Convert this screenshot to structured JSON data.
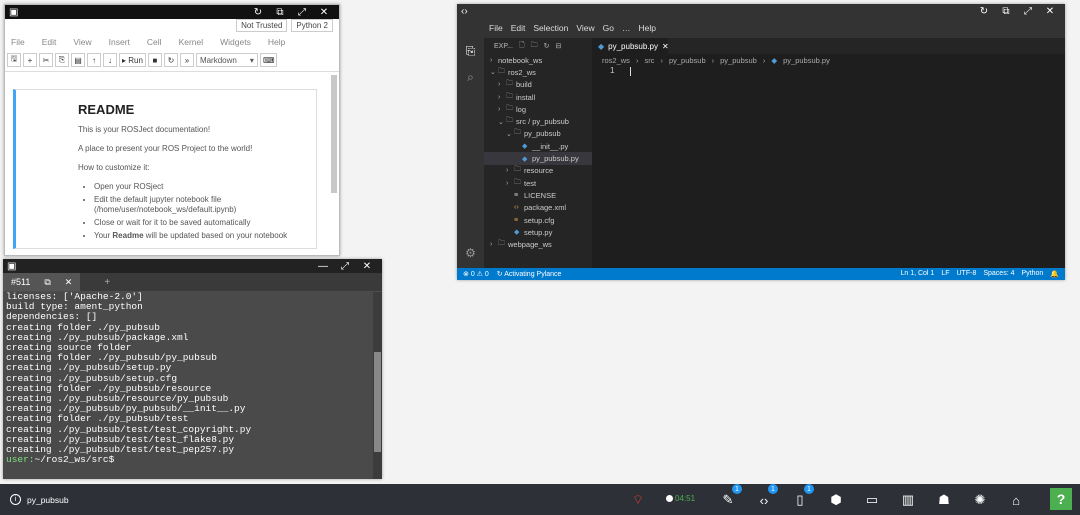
{
  "jupyter": {
    "trust_label": "Not Trusted",
    "kernel_label": "Python 2",
    "menu": [
      "File",
      "Edit",
      "View",
      "Insert",
      "Cell",
      "Kernel",
      "Widgets",
      "Help"
    ],
    "run_label": "Run",
    "cell_type": "Markdown",
    "readme": {
      "title": "README",
      "p1": "This is your ROSJect documentation!",
      "p2": "A place to present your ROS Project to the world!",
      "p3": "How to customize it:",
      "li1": "Open your ROSject",
      "li2": "Edit the default jupyter notebook file (/home/user/notebook_ws/default.ipynb)",
      "li3": "Close or wait for it to be saved automatically",
      "li4_pre": "Your ",
      "li4_bold": "Readme",
      "li4_post": " will be updated based on your notebook"
    }
  },
  "terminal": {
    "tab_label": "#511",
    "lines": [
      "licenses: ['Apache-2.0']",
      "build type: ament_python",
      "dependencies: []",
      "creating folder ./py_pubsub",
      "creating ./py_pubsub/package.xml",
      "creating source folder",
      "creating folder ./py_pubsub/py_pubsub",
      "creating ./py_pubsub/setup.py",
      "creating ./py_pubsub/setup.cfg",
      "creating folder ./py_pubsub/resource",
      "creating ./py_pubsub/resource/py_pubsub",
      "creating ./py_pubsub/py_pubsub/__init__.py",
      "creating folder ./py_pubsub/test",
      "creating ./py_pubsub/test/test_copyright.py",
      "creating ./py_pubsub/test/test_flake8.py",
      "creating ./py_pubsub/test/test_pep257.py"
    ],
    "prompt_user": "user:",
    "prompt_path": "~/ros2_ws/src$"
  },
  "vscode": {
    "menu": [
      "File",
      "Edit",
      "Selection",
      "View",
      "Go",
      "Help"
    ],
    "explorer_label": "EXP...",
    "tree": [
      {
        "label": "notebook_ws",
        "depth": 0,
        "chev": ">",
        "icon": ""
      },
      {
        "label": "ros2_ws",
        "depth": 0,
        "chev": "v",
        "icon": "folder"
      },
      {
        "label": "build",
        "depth": 1,
        "chev": ">",
        "icon": "folder"
      },
      {
        "label": "install",
        "depth": 1,
        "chev": ">",
        "icon": "folder"
      },
      {
        "label": "log",
        "depth": 1,
        "chev": ">",
        "icon": "folder"
      },
      {
        "label": "src / py_pubsub",
        "depth": 1,
        "chev": "v",
        "icon": "folder"
      },
      {
        "label": "py_pubsub",
        "depth": 2,
        "chev": "v",
        "icon": "folder"
      },
      {
        "label": "__init__.py",
        "depth": 3,
        "chev": "",
        "icon": "py"
      },
      {
        "label": "py_pubsub.py",
        "depth": 3,
        "chev": "",
        "icon": "py"
      },
      {
        "label": "resource",
        "depth": 2,
        "chev": ">",
        "icon": "folder"
      },
      {
        "label": "test",
        "depth": 2,
        "chev": ">",
        "icon": "folder"
      },
      {
        "label": "LICENSE",
        "depth": 2,
        "chev": "",
        "icon": "file"
      },
      {
        "label": "package.xml",
        "depth": 2,
        "chev": "",
        "icon": "xml"
      },
      {
        "label": "setup.cfg",
        "depth": 2,
        "chev": "",
        "icon": "cfg"
      },
      {
        "label": "setup.py",
        "depth": 2,
        "chev": "",
        "icon": "py"
      },
      {
        "label": "webpage_ws",
        "depth": 0,
        "chev": ">",
        "icon": "folder"
      }
    ],
    "active_tab": "py_pubsub.py",
    "breadcrumb": [
      "ros2_ws",
      "src",
      "py_pubsub",
      "py_pubsub",
      "py_pubsub.py"
    ],
    "line_number": "1",
    "status": {
      "errors": "0",
      "warnings": "0",
      "activity": "Activating Pylance",
      "position": "Ln 1, Col 1",
      "eol": "LF",
      "encoding": "UTF-8",
      "spaces": "Spaces: 4",
      "language": "Python"
    }
  },
  "taskbar": {
    "project_name": "py_pubsub",
    "timer": "04:51",
    "badges": [
      "1",
      "1",
      "1"
    ],
    "help_label": "?"
  }
}
